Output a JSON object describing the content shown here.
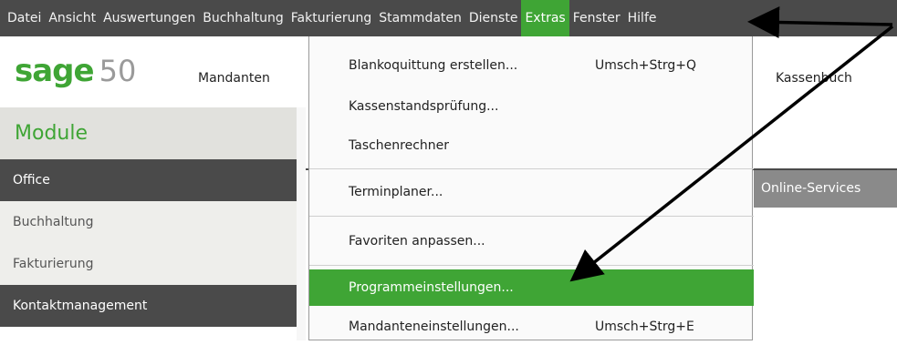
{
  "menubar": {
    "items": [
      {
        "label": "Datei"
      },
      {
        "label": "Ansicht"
      },
      {
        "label": "Auswertungen"
      },
      {
        "label": "Buchhaltung"
      },
      {
        "label": "Fakturierung"
      },
      {
        "label": "Stammdaten"
      },
      {
        "label": "Dienste"
      },
      {
        "label": "Extras"
      },
      {
        "label": "Fenster"
      },
      {
        "label": "Hilfe"
      }
    ],
    "active_color": "#3fa535"
  },
  "logo": {
    "brand": "sage",
    "number": "50"
  },
  "toolbar": {
    "mandanten": "Mandanten",
    "kassenbuch": "Kassenbuch"
  },
  "sidebar": {
    "header": "Module",
    "items": [
      {
        "label": "Office"
      },
      {
        "label": "Buchhaltung"
      },
      {
        "label": "Fakturierung"
      },
      {
        "label": "Kontaktmanagement"
      }
    ]
  },
  "online_services": "Online-Services",
  "extras_menu": {
    "items": [
      {
        "label": "Blankoquittung erstellen...",
        "shortcut": "Umsch+Strg+Q"
      },
      {
        "label": "Kassenstandsprüfung...",
        "shortcut": ""
      },
      {
        "label": "Taschenrechner",
        "shortcut": ""
      },
      {
        "label": "Terminplaner...",
        "shortcut": ""
      },
      {
        "label": "Favoriten anpassen...",
        "shortcut": ""
      },
      {
        "label": "Programmeinstellungen...",
        "shortcut": ""
      },
      {
        "label": "Mandanteneinstellungen...",
        "shortcut": "Umsch+Strg+E"
      }
    ],
    "highlight_color": "#3fa535"
  },
  "colors": {
    "dark_bar": "#4a4a4a",
    "brand_green": "#3fa535",
    "module_bg": "#e1e1dd"
  }
}
